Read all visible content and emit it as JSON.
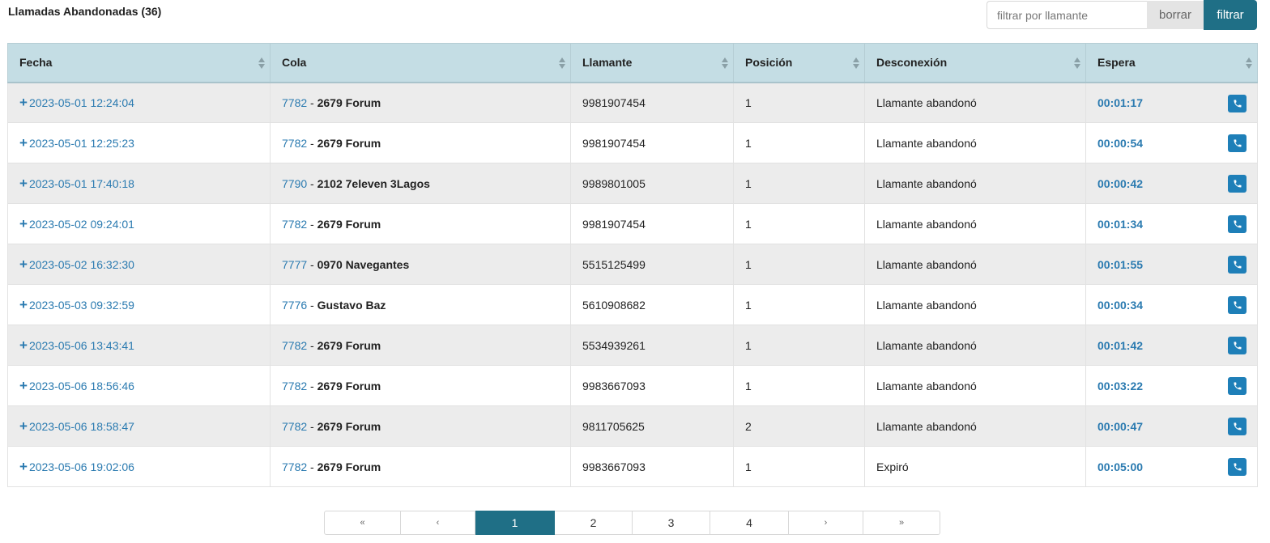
{
  "header": {
    "title": "Llamadas Abandonadas (36)"
  },
  "filter": {
    "placeholder": "filtrar por llamante",
    "clear_label": "borrar",
    "filter_label": "filtrar"
  },
  "table": {
    "columns": [
      "Fecha",
      "Cola",
      "Llamante",
      "Posición",
      "Desconexión",
      "Espera"
    ],
    "rows": [
      {
        "fecha": "2023-05-01 12:24:04",
        "cola_id": "7782",
        "cola_name": "2679 Forum",
        "llamante": "9981907454",
        "posicion": "1",
        "desconexion": "Llamante abandonó",
        "espera": "00:01:17"
      },
      {
        "fecha": "2023-05-01 12:25:23",
        "cola_id": "7782",
        "cola_name": "2679 Forum",
        "llamante": "9981907454",
        "posicion": "1",
        "desconexion": "Llamante abandonó",
        "espera": "00:00:54"
      },
      {
        "fecha": "2023-05-01 17:40:18",
        "cola_id": "7790",
        "cola_name": "2102 7eleven 3Lagos",
        "llamante": "9989801005",
        "posicion": "1",
        "desconexion": "Llamante abandonó",
        "espera": "00:00:42"
      },
      {
        "fecha": "2023-05-02 09:24:01",
        "cola_id": "7782",
        "cola_name": "2679 Forum",
        "llamante": "9981907454",
        "posicion": "1",
        "desconexion": "Llamante abandonó",
        "espera": "00:01:34"
      },
      {
        "fecha": "2023-05-02 16:32:30",
        "cola_id": "7777",
        "cola_name": "0970 Navegantes",
        "llamante": "5515125499",
        "posicion": "1",
        "desconexion": "Llamante abandonó",
        "espera": "00:01:55"
      },
      {
        "fecha": "2023-05-03 09:32:59",
        "cola_id": "7776",
        "cola_name": "Gustavo Baz",
        "llamante": "5610908682",
        "posicion": "1",
        "desconexion": "Llamante abandonó",
        "espera": "00:00:34"
      },
      {
        "fecha": "2023-05-06 13:43:41",
        "cola_id": "7782",
        "cola_name": "2679 Forum",
        "llamante": "5534939261",
        "posicion": "1",
        "desconexion": "Llamante abandonó",
        "espera": "00:01:42"
      },
      {
        "fecha": "2023-05-06 18:56:46",
        "cola_id": "7782",
        "cola_name": "2679 Forum",
        "llamante": "9983667093",
        "posicion": "1",
        "desconexion": "Llamante abandonó",
        "espera": "00:03:22"
      },
      {
        "fecha": "2023-05-06 18:58:47",
        "cola_id": "7782",
        "cola_name": "2679 Forum",
        "llamante": "9811705625",
        "posicion": "2",
        "desconexion": "Llamante abandonó",
        "espera": "00:00:47"
      },
      {
        "fecha": "2023-05-06 19:02:06",
        "cola_id": "7782",
        "cola_name": "2679 Forum",
        "llamante": "9983667093",
        "posicion": "1",
        "desconexion": "Expiró",
        "espera": "00:05:00"
      }
    ]
  },
  "pagination": {
    "first": "«",
    "prev": "‹",
    "pages": [
      "1",
      "2",
      "3",
      "4"
    ],
    "current": "1",
    "next": "›",
    "last": "»"
  },
  "icons": {
    "expand": "plus-icon",
    "call": "phone-icon",
    "sort": "sort-icon"
  },
  "colors": {
    "accent": "#1f6f86",
    "link": "#2a7ab0",
    "header_bg": "#c4dde4",
    "stripe": "#ececec",
    "call_button": "#1e7fb8"
  }
}
